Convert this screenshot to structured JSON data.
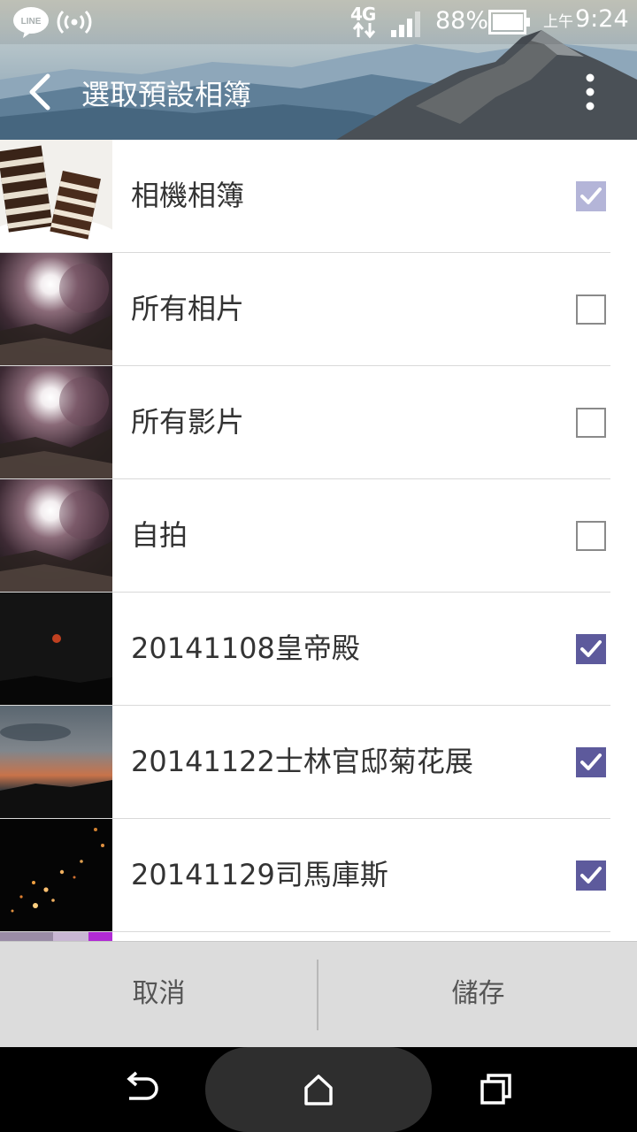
{
  "status_bar": {
    "line_badge": "LINE",
    "network_type": "4G",
    "battery_percent": "88%",
    "time_period": "上午",
    "time": "9:24"
  },
  "header": {
    "title": "選取預設相簿"
  },
  "albums": [
    {
      "label": "相機相簿",
      "checked": true,
      "disabled": true,
      "thumb": "cake"
    },
    {
      "label": "所有相片",
      "checked": false,
      "disabled": false,
      "thumb": "sunburst"
    },
    {
      "label": "所有影片",
      "checked": false,
      "disabled": false,
      "thumb": "sunburst"
    },
    {
      "label": "自拍",
      "checked": false,
      "disabled": false,
      "thumb": "sunburst"
    },
    {
      "label": "20141108皇帝殿",
      "checked": true,
      "disabled": false,
      "thumb": "night-moon"
    },
    {
      "label": "20141122士林官邸菊花展",
      "checked": true,
      "disabled": false,
      "thumb": "sunset"
    },
    {
      "label": "20141129司馬庫斯",
      "checked": true,
      "disabled": false,
      "thumb": "night-lights"
    }
  ],
  "actions": {
    "cancel": "取消",
    "save": "儲存"
  },
  "colors": {
    "checked": "#5d5a9c",
    "checked_disabled": "#b4b5d8"
  }
}
